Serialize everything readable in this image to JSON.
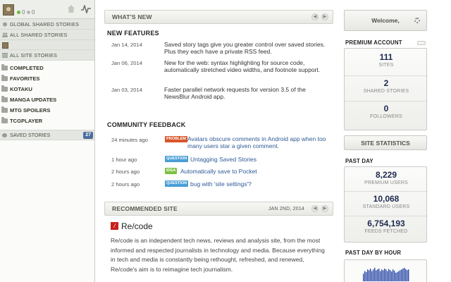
{
  "sidebar": {
    "counts": {
      "positive": "0",
      "neutral": "0"
    },
    "rows": [
      {
        "label": "Global Shared Stories",
        "icon": "globe-icon"
      },
      {
        "label": "All Shared Stories",
        "icon": "people-icon"
      }
    ],
    "all_site_stories": "All Site Stories",
    "folders": [
      "Completed",
      "Favorites",
      "Kotaku",
      "Manga Updates",
      "MTG Spoilers",
      "TCGPlayer"
    ],
    "saved_stories": {
      "label": "Saved Stories",
      "count": "27"
    }
  },
  "whats_new": {
    "title": "What's New",
    "features_title": "New Features",
    "features": [
      {
        "date": "Jan 14, 2014",
        "text": "Saved story tags give you greater control over saved stories. Plus they each have a private RSS feed."
      },
      {
        "date": "Jan 06, 2014",
        "text": "New for the web: syntax highlighting for source code, automatically stretched video widths, and footnote support."
      },
      {
        "date": "Jan 03, 2014",
        "text": "Faster parallel network requests for version 3.5 of the NewsBlur Android app."
      }
    ],
    "feedback_title": "Community Feedback",
    "feedback": [
      {
        "time": "24 minutes ago",
        "tag": "Problem",
        "tag_color": "#d8572a",
        "title": "Avatars obscure comments in Android app when too many users star a given comment."
      },
      {
        "time": "1 hour ago",
        "tag": "Question",
        "tag_color": "#4a9ed6",
        "title": "Untagging Saved Stories"
      },
      {
        "time": "2 hours ago",
        "tag": "Idea",
        "tag_color": "#7cc040",
        "title": "Automatically save to Pocket"
      },
      {
        "time": "2 hours ago",
        "tag": "Question",
        "tag_color": "#4a9ed6",
        "title": "bug with 'site settings'?"
      }
    ]
  },
  "recommended": {
    "title": "Recommended Site",
    "date": "Jan 2nd, 2014",
    "site_name": "Re/code",
    "icon_letter": "/",
    "description": "Re/code is an independent tech news, reviews and analysis site, from the most informed and respected journalists in technology and media. Because everything in tech and media is constantly being rethought, refreshed, and renewed, Re/code's aim is to reimagine tech journalism."
  },
  "welcome": {
    "title": "Welcome,"
  },
  "premium": {
    "title": "Premium Account",
    "stats": [
      {
        "value": "111",
        "label": "Sites"
      },
      {
        "value": "2",
        "label": "Shared Stories"
      },
      {
        "value": "0",
        "label": "Followers"
      }
    ]
  },
  "site_stats": {
    "title": "Site Statistics",
    "past_day_title": "Past Day",
    "stats": [
      {
        "value": "8,229",
        "label": "Premium Users"
      },
      {
        "value": "10,068",
        "label": "Standard Users"
      },
      {
        "value": "6,754,193",
        "label": "Feeds Fetched"
      }
    ],
    "by_hour_title": "Past Day By Hour",
    "bar_color": "#2b4aa8",
    "by_hour_values": [
      0.45,
      0.6,
      0.55,
      0.7,
      0.65,
      0.75,
      0.6,
      0.7,
      0.8,
      0.65,
      0.7,
      0.75,
      0.6,
      0.7,
      0.65,
      0.75,
      0.7,
      0.6,
      0.72,
      0.66,
      0.58,
      0.7,
      0.62,
      0.5,
      0.55,
      0.6,
      0.65,
      0.7,
      0.75,
      0.8,
      0.72,
      0.66,
      0.7
    ]
  }
}
